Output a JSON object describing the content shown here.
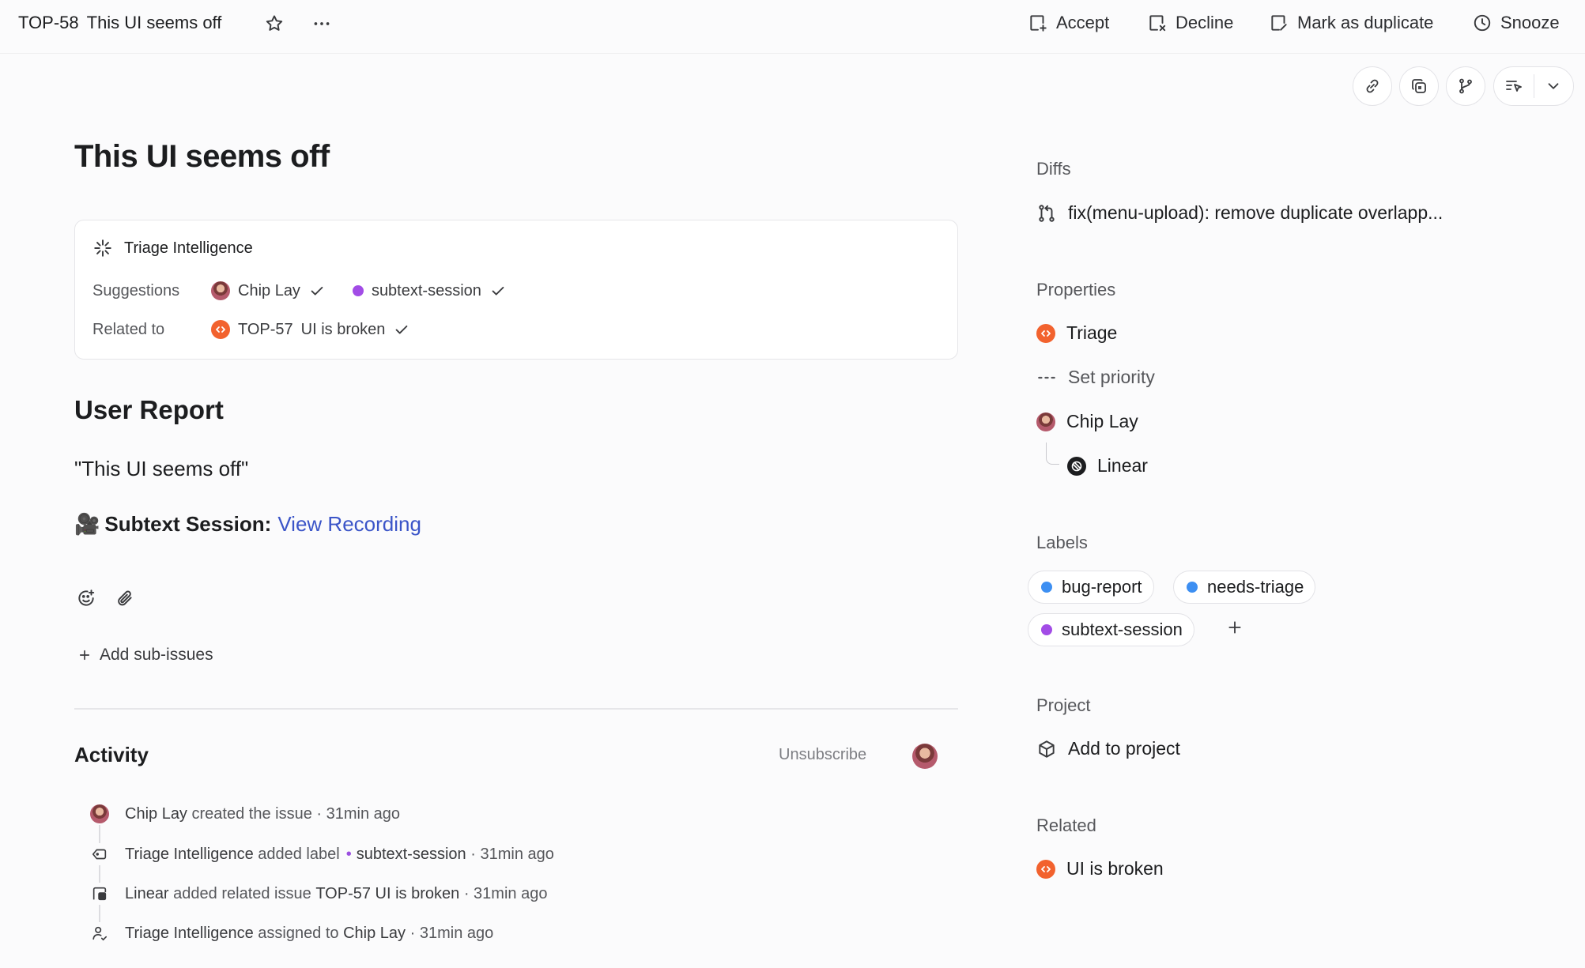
{
  "topbar": {
    "issue_id": "TOP-58",
    "issue_title": "This UI seems off",
    "actions": {
      "accept": "Accept",
      "decline": "Decline",
      "duplicate": "Mark as duplicate",
      "snooze": "Snooze"
    }
  },
  "issue": {
    "title": "This UI seems off"
  },
  "triage": {
    "heading": "Triage Intelligence",
    "suggestions_label": "Suggestions",
    "suggestions": [
      {
        "text": "Chip Lay"
      },
      {
        "text": "subtext-session",
        "color": "#a24ce6"
      }
    ],
    "related_label": "Related to",
    "related": {
      "id": "TOP-57",
      "title": "UI is broken"
    }
  },
  "body": {
    "heading": "User Report",
    "quote": "\"This UI seems off\"",
    "session_emoji": "🎥",
    "session_label": "Subtext Session:",
    "session_link": "View Recording",
    "add_sub_issues": "Add sub-issues"
  },
  "activity": {
    "heading": "Activity",
    "unsubscribe": "Unsubscribe",
    "items": [
      {
        "actor": "Chip Lay",
        "text": "created the issue",
        "time": "31min ago"
      },
      {
        "actor": "Triage Intelligence",
        "text": "added label",
        "label": "subtext-session",
        "time": "31min ago"
      },
      {
        "actor": "Linear",
        "text": "added related issue",
        "ref": "TOP-57 UI is broken",
        "time": "31min ago"
      },
      {
        "actor": "Triage Intelligence",
        "text": "assigned to",
        "target": "Chip Lay",
        "time": "31min ago"
      }
    ],
    "separator": "·"
  },
  "sidebar": {
    "diffs_heading": "Diffs",
    "diff": "fix(menu-upload): remove duplicate overlapp...",
    "properties_heading": "Properties",
    "status": "Triage",
    "priority": "Set priority",
    "assignee": "Chip Lay",
    "team": "Linear",
    "labels_heading": "Labels",
    "labels": [
      {
        "name": "bug-report",
        "color": "#3d8ff2"
      },
      {
        "name": "needs-triage",
        "color": "#3d8ff2"
      },
      {
        "name": "subtext-session",
        "color": "#a24ce6"
      }
    ],
    "project_heading": "Project",
    "project": "Add to project",
    "related_heading": "Related",
    "related": "UI is broken"
  }
}
